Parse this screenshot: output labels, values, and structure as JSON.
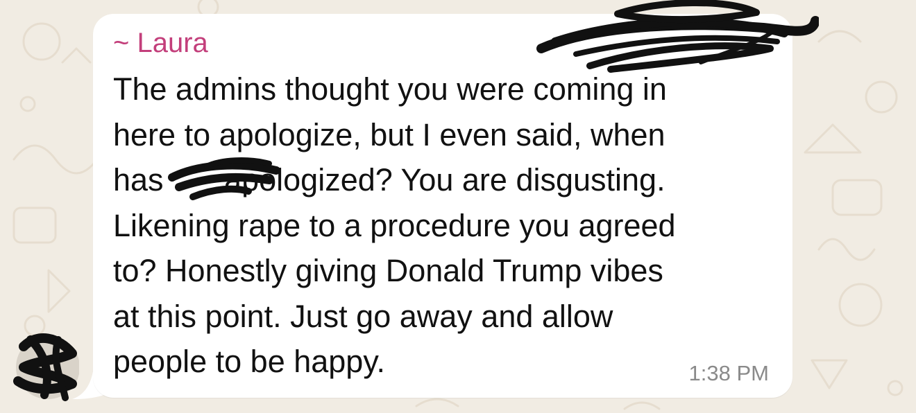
{
  "chat": {
    "sender_name": "~ Laura",
    "message_lines": [
      "The admins thought you were coming in",
      "here to apologize, but I even said, when",
      "has       apologized? You are disgusting.",
      "Likening rape to a procedure you agreed",
      "to? Honestly giving Donald Trump vibes",
      "at this point. Just go away and allow",
      "people to be happy."
    ],
    "timestamp": "1:38 PM"
  },
  "colors": {
    "sender_name": "#c33f7b",
    "bubble_background": "#ffffff",
    "wallpaper": "#f1ece3",
    "timestamp": "#8a8a8a",
    "redaction_ink": "#111111"
  },
  "icons": {
    "avatar": "avatar-icon",
    "redactions": [
      "redaction-scribble-icon"
    ]
  }
}
